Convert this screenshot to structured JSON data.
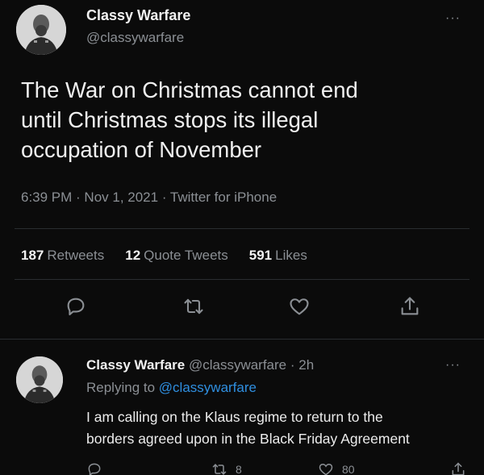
{
  "tweet": {
    "display_name": "Classy Warfare",
    "handle": "@classywarfare",
    "text_lines": [
      "The War on Christmas cannot end",
      "until Christmas stops its illegal",
      "occupation of November"
    ],
    "meta": "6:39 PM · Nov 1, 2021 · Twitter for iPhone",
    "stats": {
      "retweets_count": "187",
      "retweets_label": "Retweets",
      "quotes_count": "12",
      "quotes_label": "Quote Tweets",
      "likes_count": "591",
      "likes_label": "Likes"
    },
    "more_label": "···",
    "icons": [
      "reply-icon",
      "retweet-icon",
      "like-icon",
      "share-icon"
    ]
  },
  "reply": {
    "display_name": "Classy Warfare",
    "handle_time": "@classywarfare · 2h",
    "replying_prefix": "Replying to",
    "replying_mention": "@classywarfare",
    "text_lines": [
      "I am calling on the Klaus regime to return to the",
      "borders agreed upon in the Black Friday Agreement"
    ],
    "retweet_count": "8",
    "like_count": "80",
    "more_label": "···"
  },
  "colors": {
    "background": "#0b0b0b",
    "muted": "#8b8f94",
    "link": "#2f8fe0",
    "text": "#f0f0f0"
  }
}
